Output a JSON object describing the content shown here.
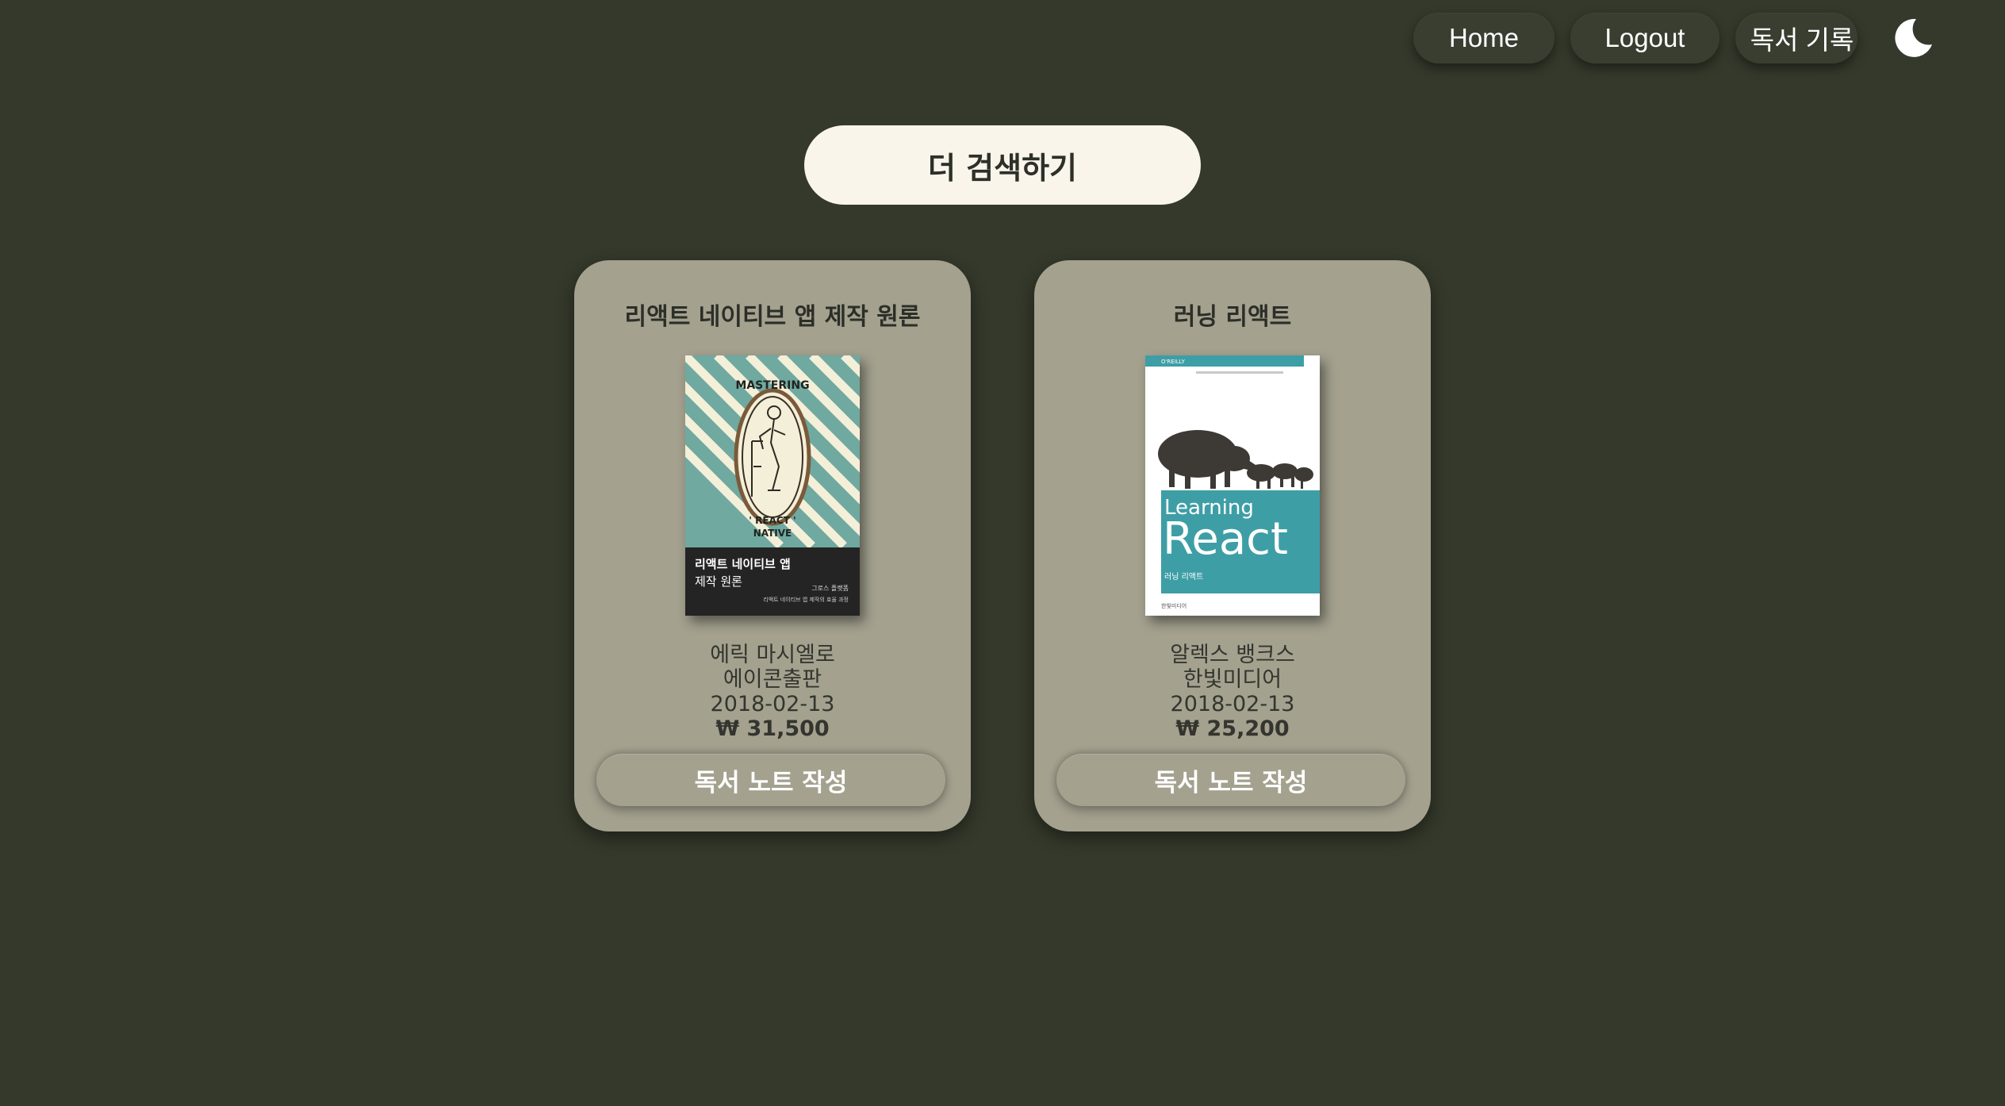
{
  "nav": {
    "home_label": "Home",
    "logout_label": "Logout",
    "records_label": "독서 기록",
    "theme_icon": "moon-icon"
  },
  "search_more_label": "더 검색하기",
  "books": [
    {
      "title": "리액트 네이티브 앱 제작 원론",
      "author": "에릭 마시엘로",
      "publisher": "에이콘출판",
      "date": "2018-02-13",
      "price": "₩ 31,500",
      "button_label": "독서 노트 작성",
      "cover": {
        "top_text": "MASTERING",
        "bottom_text_1": "' REACT '",
        "bottom_text_2": "NATIVE",
        "band_title_1": "리액트 네이티브 앱",
        "band_title_2": "제작 원론",
        "band_sub_1": "그로스 플랫폼",
        "band_sub_2": "리액트 네이티브 앱 제작의 효율 과정"
      }
    },
    {
      "title": "러닝 리액트",
      "author": "알렉스 뱅크스",
      "publisher": "한빛미디어",
      "date": "2018-02-13",
      "price": "₩ 25,200",
      "button_label": "독서 노트 작성",
      "cover": {
        "brand": "O'REILLY",
        "line1": "Learning",
        "line2": "React",
        "subtitle": "러닝 리액트",
        "publisher_mark": "한빛미디어"
      }
    }
  ],
  "colors": {
    "background": "#35392b",
    "card": "#a4a18f",
    "search_button": "#f9f5ea",
    "cover1_teal": "#6fa9a0",
    "cover2_teal": "#3e9ea6"
  }
}
